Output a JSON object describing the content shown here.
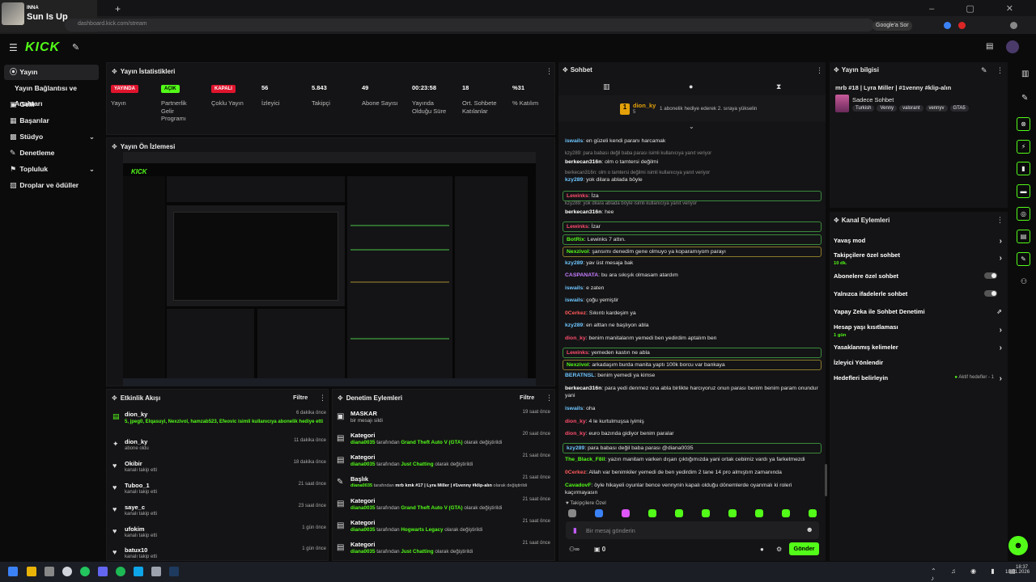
{
  "media": {
    "artist": "INNA",
    "song": "Sun Is Up"
  },
  "browser": {
    "url": "dashboard.kick.com/stream",
    "google_chip": "Google'a Sor"
  },
  "brand": {
    "logo": "KICK",
    "accent": "#53fc18"
  },
  "sidebar": {
    "items": [
      {
        "label": "Yayın",
        "icon": "live-icon"
      },
      {
        "label": "Yayın Bağlantısı ve Anahtarı",
        "icon": ""
      },
      {
        "label": "Gelir",
        "icon": "wallet-icon"
      },
      {
        "label": "Başarılar",
        "icon": "trophy-icon"
      },
      {
        "label": "Stüdyo",
        "icon": "studio-icon"
      },
      {
        "label": "Denetleme",
        "icon": "wrench-icon"
      },
      {
        "label": "Topluluk",
        "icon": "community-icon"
      },
      {
        "label": "Droplar ve ödüller",
        "icon": "gift-icon"
      }
    ]
  },
  "stats_panel": {
    "title": "Yayın İstatistikleri",
    "items": [
      {
        "value": "YAYINDA",
        "label": "Yayın"
      },
      {
        "value": "AÇIK",
        "label": "Partnerlik Gelir Programı"
      },
      {
        "value": "KAPALI",
        "label": "Çoklu Yayın"
      },
      {
        "value": "56",
        "label": "İzleyici"
      },
      {
        "value": "5.843",
        "label": "Takipçi"
      },
      {
        "value": "49",
        "label": "Abone Sayısı"
      },
      {
        "value": "00:23:58",
        "label": "Yayında Olduğu Süre"
      },
      {
        "value": "18",
        "label": "Ort. Sohbete Katılanlar"
      },
      {
        "value": "%31",
        "label": "% Katılım"
      }
    ]
  },
  "preview_panel": {
    "title": "Yayın Ön İzlemesi"
  },
  "activity_panel": {
    "title": "Etkinlik Akışı",
    "filter": "Filtre",
    "rows": [
      {
        "name": "dion_ky",
        "detail": "5, jpeg0, Elqasuyi, Nexzivol, hamzab523, Efeovic isimli kullanıcıya abonelik hediye etti",
        "time": "6 dakika önce"
      },
      {
        "name": "dion_ky",
        "detail": "abone oldu",
        "time": "11 dakika önce"
      },
      {
        "name": "Okibir",
        "detail": "kanalı takip etti",
        "time": "18 dakika önce"
      },
      {
        "name": "Tuboo_1",
        "detail": "kanalı takip etti",
        "time": "21 saat önce"
      },
      {
        "name": "saye_c",
        "detail": "kanalı takip etti",
        "time": "23 saat önce"
      },
      {
        "name": "ufokim",
        "detail": "kanalı takip etti",
        "time": "1 gün önce"
      },
      {
        "name": "batux10",
        "detail": "kanalı takip etti",
        "time": "1 gün önce"
      }
    ]
  },
  "mod_panel": {
    "title": "Denetim Eylemleri",
    "filter": "Filtre",
    "rows": [
      {
        "name": "MASKAR",
        "user": "",
        "by": "bir mesajı sildi",
        "value": "",
        "suffix": "",
        "time": "19 saat önce"
      },
      {
        "name": "Kategori",
        "user": "diana0035",
        "by": "tarafından",
        "value": "Grand Theft Auto V (GTA)",
        "suffix": "olarak değiştirildi",
        "time": "20 saat önce"
      },
      {
        "name": "Kategori",
        "user": "diana0035",
        "by": "tarafından",
        "value": "Just Chatting",
        "suffix": "olarak değiştirildi",
        "time": "21 saat önce"
      },
      {
        "name": "Başlık",
        "user": "diana0035",
        "by": "tarafından",
        "value": "mrb kmk #17 | Lyra Miller | #1venny #klip-alın",
        "suffix": "olarak değiştirildi",
        "time": "21 saat önce"
      },
      {
        "name": "Kategori",
        "user": "diana0035",
        "by": "tarafından",
        "value": "Grand Theft Auto V (GTA)",
        "suffix": "olarak değiştirildi",
        "time": "21 saat önce"
      },
      {
        "name": "Kategori",
        "user": "diana0035",
        "by": "tarafından",
        "value": "Hogwarts Legacy",
        "suffix": "olarak değiştirildi",
        "time": "21 saat önce"
      },
      {
        "name": "Kategori",
        "user": "diana0035",
        "by": "tarafından",
        "value": "Just Chatting",
        "suffix": "olarak değiştirildi",
        "time": "21 saat önce"
      }
    ]
  },
  "chat": {
    "title": "Sohbet",
    "pinned_user": "dion_ky",
    "pinned_count": "5",
    "pinned_text": "1 abonelik hediye ederek 2. sıraya yükselin",
    "messages": [
      {
        "user": "iswails",
        "color": "#6ec6ff",
        "text": "en güzeli kendi paranı harcamak",
        "style": "plain"
      },
      {
        "user": "",
        "color": "#888",
        "text": "kzy289: para babası değil baba parası isimli kullanıcıya yanıt veriyor",
        "style": "reply"
      },
      {
        "user": "berkecan316n",
        "color": "#ffffff",
        "text": "olm o tamtersi değilmi",
        "style": "plain"
      },
      {
        "user": "",
        "color": "#888",
        "text": "berkecan316n: olm o tamtersi değilmi isimli kullanıcıya yanıt veriyor",
        "style": "reply"
      },
      {
        "user": "kzy289",
        "color": "#6ec6ff",
        "text": "yok dilara ablada böyle",
        "style": "plain"
      },
      {
        "user": "Lewinks",
        "color": "#ff4d6d",
        "text": "İza",
        "style": "boxed"
      },
      {
        "user": "",
        "color": "#888",
        "text": "kzy289: yok dilara ablada böyle isimli kullanıcıya yanıt veriyor",
        "style": "reply"
      },
      {
        "user": "berkecan316n",
        "color": "#ffffff",
        "text": "hee",
        "style": "plain"
      },
      {
        "user": "Lewinks",
        "color": "#ff4d6d",
        "text": "İzar",
        "style": "boxed"
      },
      {
        "user": "BotRix",
        "color": "#53fc18",
        "text": "Lewinks 7 attın.",
        "style": "boxed"
      },
      {
        "user": "Nexzivol",
        "color": "#53fc18",
        "text": "şansımı denedim gene olmuyo ya koparamıyom parayı",
        "style": "gold"
      },
      {
        "user": "kzy289",
        "color": "#6ec6ff",
        "text": "yav üst mesaja bak",
        "style": "plain"
      },
      {
        "user": "CASPANATA",
        "color": "#c77dff",
        "text": "bu ara sıkışık olmasam atardım",
        "style": "plain"
      },
      {
        "user": "iswails",
        "color": "#6ec6ff",
        "text": "e zaten",
        "style": "plain"
      },
      {
        "user": "iswails",
        "color": "#6ec6ff",
        "text": "çoğu yemiştir",
        "style": "plain"
      },
      {
        "user": "0Cerkez",
        "color": "#ff5a5a",
        "text": "Sıkıntı kardeşim ya",
        "style": "plain"
      },
      {
        "user": "kzy289",
        "color": "#6ec6ff",
        "text": "en alttan ne başlıyon abla",
        "style": "plain"
      },
      {
        "user": "dion_ky",
        "color": "#ff4d6d",
        "text": "benim manitalarım yemedi ben yedirdim aptalım ben",
        "style": "plain"
      },
      {
        "user": "Lewinks",
        "color": "#ff4d6d",
        "text": "yemeden kastın ne abla",
        "style": "boxed"
      },
      {
        "user": "Nexzivol",
        "color": "#53fc18",
        "text": "arkadaşım burda manita yaptı 100k borcu var bankaya",
        "style": "gold"
      },
      {
        "user": "BERATNSL",
        "color": "#6ec6ff",
        "text": "benim yemedi ya kimse",
        "style": "plain"
      },
      {
        "user": "berkecan316n",
        "color": "#ffffff",
        "text": "para yedi denmez ona abla birlikte harcıyoruz onun parası benim benim param onundur yani",
        "style": "plain"
      },
      {
        "user": "iswails",
        "color": "#6ec6ff",
        "text": "oha",
        "style": "plain"
      },
      {
        "user": "dion_ky",
        "color": "#ff4d6d",
        "text": "4 le kurtulmuşsa iyimiş",
        "style": "plain"
      },
      {
        "user": "dion_ky",
        "color": "#ff4d6d",
        "text": "euro bazında gidiyor benim paralar",
        "style": "plain"
      },
      {
        "user": "kzy289",
        "color": "#6ec6ff",
        "text": "para babası değil baba parası @diana0035",
        "style": "boxed"
      },
      {
        "user": "The_Black_F8ll",
        "color": "#53fc18",
        "text": "yazın manitam varken dışarı çıktığımızda yani ortak cebimiz vardı ya farketmezdi",
        "style": "plain"
      },
      {
        "user": "0Cerkez",
        "color": "#ff5a5a",
        "text": "Allah var benimkiler yemedi de ben yedirdim 2 tane 14 pro almıştım zamanında",
        "style": "plain"
      },
      {
        "user": "CavadovF",
        "color": "#53fc18",
        "text": "öyle hikayeli oyunlar bence vennynin kapalı olduğu dönemlerde oyanmalı ki roleri kaçırmayasın",
        "style": "plain"
      }
    ],
    "followers_only_label": "Takipçilere Özel",
    "input_placeholder": "Bir mesaj gönderin",
    "points": "0",
    "send": "Gönder"
  },
  "stream_info": {
    "title": "Yayın bilgisi",
    "stream_title": "mrb #18 | Lyra Miller | #1venny #klip-alın",
    "category": "Sadece Sohbet",
    "tags": [
      "Turkish",
      "Venny",
      "valorant",
      "vennyv",
      "GTA5"
    ]
  },
  "channel_actions": {
    "title": "Kanal Eylemleri",
    "items": [
      {
        "label": "Yavaş mod",
        "sub": "",
        "control": "chevron"
      },
      {
        "label": "Takipçilere özel sohbet",
        "sub": "10 dk.",
        "control": "chevron"
      },
      {
        "label": "Abonelere özel sohbet",
        "sub": "",
        "control": "toggle"
      },
      {
        "label": "Yalnızca ifadelerle sohbet",
        "sub": "",
        "control": "toggle"
      },
      {
        "label": "Yapay Zeka ile Sohbet Denetimi",
        "sub": "",
        "control": "external"
      },
      {
        "label": "Hesap yaşı kısıtlaması",
        "sub": "1 gün",
        "control": "chevron"
      },
      {
        "label": "Yasaklanmış kelimeler",
        "sub": "",
        "control": "chevron"
      },
      {
        "label": "İzleyici Yönlendir",
        "sub": "",
        "control": "none"
      },
      {
        "label": "Hedefleri belirleyin",
        "sub": "",
        "control": "goal",
        "status": "Aktif hedefler - 1"
      }
    ]
  },
  "taskbar": {
    "time": "18:37",
    "date": "18.01.2026"
  }
}
